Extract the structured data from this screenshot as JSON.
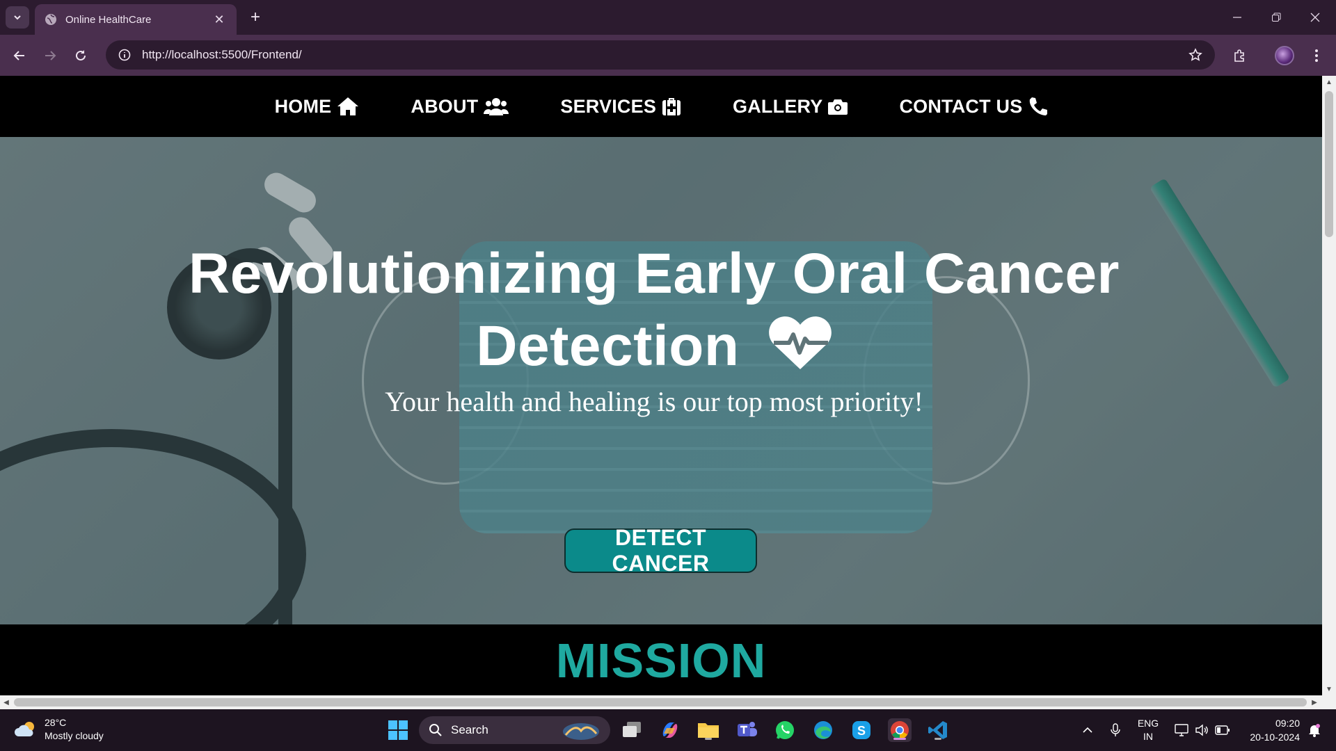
{
  "browser": {
    "tab_title": "Online HealthCare",
    "url": "http://localhost:5500/Frontend/"
  },
  "site": {
    "nav": [
      {
        "label": "HOME",
        "icon": "home-icon"
      },
      {
        "label": "ABOUT",
        "icon": "users-icon"
      },
      {
        "label": "SERVICES",
        "icon": "medkit-icon"
      },
      {
        "label": "GALLERY",
        "icon": "camera-icon"
      },
      {
        "label": "CONTACT US",
        "icon": "phone-icon"
      }
    ],
    "hero": {
      "headline_line1": "Revolutionizing Early Oral Cancer",
      "headline_line2": "Detection",
      "tagline": "Your health and healing is our top most priority!",
      "cta": "DETECT CANCER"
    },
    "mission_title": "MISSION",
    "colors": {
      "accent": "#1fa9a0",
      "cta_bg": "#0b8a8a",
      "nav_bg": "#000000"
    }
  },
  "taskbar": {
    "weather_temp": "28°C",
    "weather_desc": "Mostly cloudy",
    "search_label": "Search",
    "lang_line1": "ENG",
    "lang_line2": "IN",
    "time": "09:20",
    "date": "20-10-2024"
  }
}
